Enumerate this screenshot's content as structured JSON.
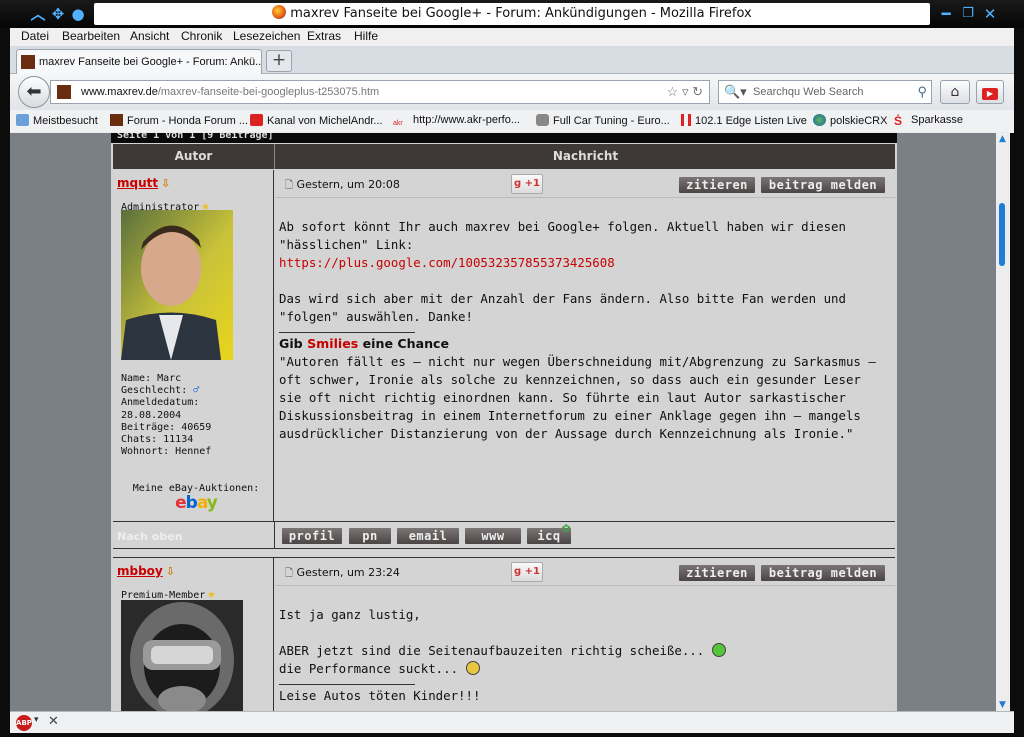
{
  "window": {
    "title": "maxrev Fanseite bei Google+ - Forum: Ankündigungen - Mozilla Firefox"
  },
  "menu": [
    "Datei",
    "Bearbeiten",
    "Ansicht",
    "Chronik",
    "Lesezeichen",
    "Extras",
    "Hilfe"
  ],
  "tab": {
    "label": "maxrev Fanseite bei Google+ - Forum: Ankü...",
    "new_tab": "+"
  },
  "url": {
    "domain": "www.maxrev.de",
    "path": "/maxrev-fanseite-bei-googleplus-t253075.htm"
  },
  "search": {
    "placeholder": "Searchqu Web Search"
  },
  "bookmarks": [
    "Meistbesucht",
    "Forum - Honda Forum ...",
    "Kanal von MichelAndr...",
    "http://www.akr-perfo...",
    "Full Car Tuning - Euro...",
    "102.1 Edge Listen Live",
    "polskieCRX",
    "Sparkasse"
  ],
  "forum": {
    "page_info": "Seite 1 von 1 [9 Beiträge]",
    "col_author": "Autor",
    "col_message": "Nachricht",
    "nach_oben": "Nach oben",
    "gplus": "+1",
    "quote_btn": "zitieren",
    "report_btn": "beitrag melden",
    "footer_buttons": [
      "profil",
      "pn",
      "email",
      "www",
      "icq"
    ],
    "posts": [
      {
        "username": "mqutt",
        "role": "Administrator",
        "info": {
          "name": "Name: Marc",
          "gender": "Geschlecht:",
          "joined_label": "Anmeldedatum:",
          "joined": "28.08.2004",
          "posts": "Beiträge: 40659",
          "chats": "Chats: 11134",
          "location": "Wohnort: Hennef"
        },
        "ebay_label": "Meine eBay-Auktionen:",
        "ebay_logo": "ebay",
        "date": "Gestern, um 20:08",
        "body1": "Ab sofort könnt Ihr auch maxrev bei Google+ folgen. Aktuell haben wir diesen \"hässlichen\" Link:",
        "link": "https://plus.google.com/100532357855373425608",
        "body2": "Das wird sich aber mit der Anzahl der Fans ändern. Also bitte Fan werden und \"folgen\" auswählen. Danke!",
        "sig_title_a": "Gib ",
        "sig_title_b": "Smilies",
        "sig_title_c": " eine Chance",
        "sig_text": "\"Autoren fällt es – nicht nur wegen Überschneidung mit/Abgrenzung zu Sarkasmus – oft schwer, Ironie als solche zu kennzeichnen, so dass auch ein gesunder Leser sie oft nicht richtig einordnen kann. So führte ein laut Autor sarkastischer Diskussionsbeitrag in einem Internetforum zu einer Anklage gegen ihn – mangels ausdrücklicher Distanzierung von der Aussage durch Kennzeichnung als Ironie.\""
      },
      {
        "username": "mbboy",
        "role": "Premium-Member",
        "date": "Gestern, um 23:24",
        "line1": "Ist ja ganz lustig,",
        "line2": "ABER jetzt sind die Seitenaufbauzeiten richtig scheiße...",
        "line3": "die Performance suckt...",
        "sig": "Leise Autos töten Kinder!!!"
      }
    ]
  },
  "colors": {
    "accent_red": "#c80000",
    "header_dark": "#3e3836",
    "button": "#5e5858",
    "scroll_blue": "#1e7dd6"
  }
}
